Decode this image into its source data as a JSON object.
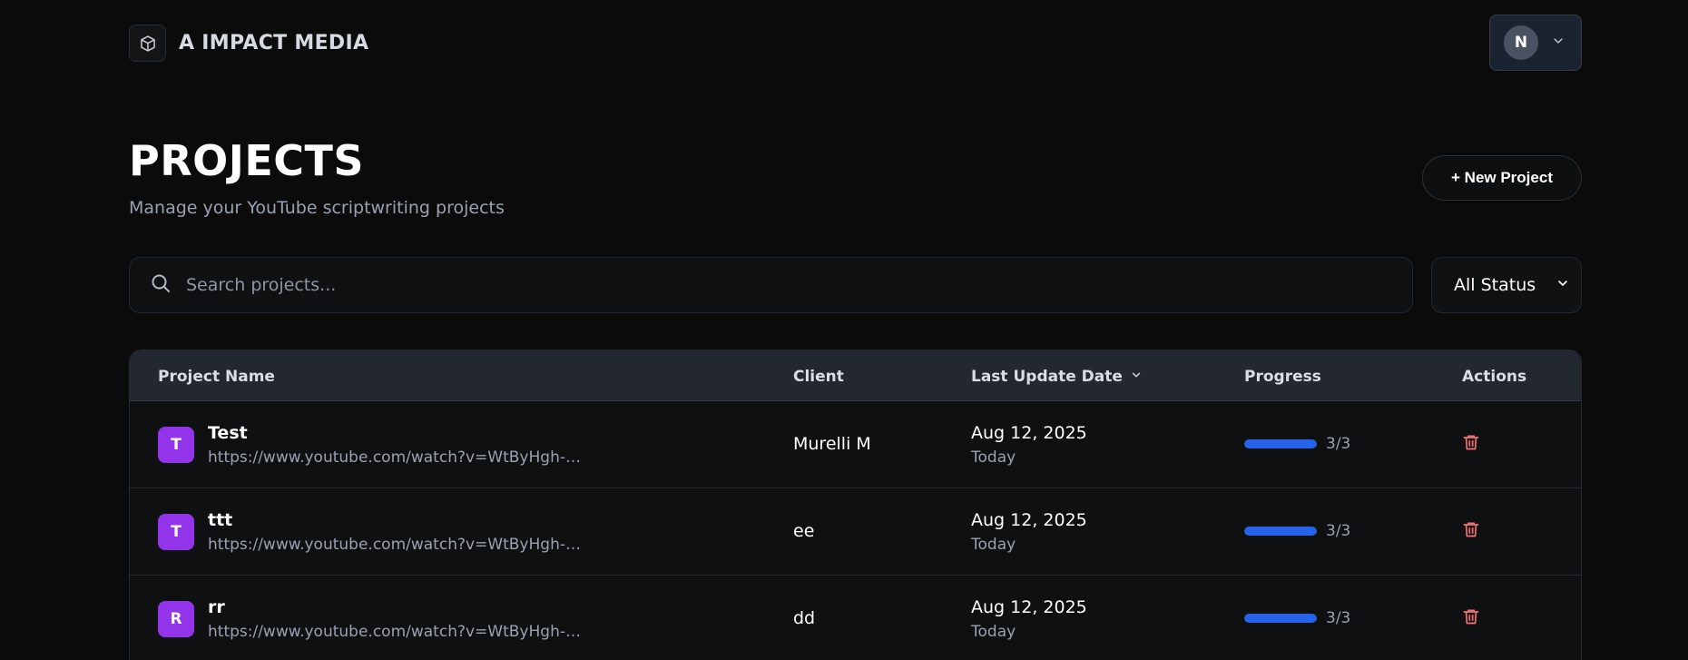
{
  "brand": {
    "name": "A IMPACT MEDIA"
  },
  "user": {
    "initial": "N"
  },
  "header": {
    "title": "PROJECTS",
    "subtitle": "Manage your YouTube scriptwriting projects",
    "new_project_label": "+ New Project"
  },
  "search": {
    "placeholder": "Search projects...",
    "value": ""
  },
  "filter": {
    "selected": "All Status"
  },
  "table": {
    "columns": {
      "name": "Project Name",
      "client": "Client",
      "date": "Last Update Date",
      "progress": "Progress",
      "actions": "Actions"
    },
    "rows": [
      {
        "initial": "T",
        "name": "Test",
        "url": "https://www.youtube.com/watch?v=WtByHgh-75...",
        "client": "Murelli M",
        "date": "Aug 12, 2025",
        "relative": "Today",
        "progress_text": "3/3",
        "progress_fraction": 1.0
      },
      {
        "initial": "T",
        "name": "ttt",
        "url": "https://www.youtube.com/watch?v=WtByHgh-75...",
        "client": "ee",
        "date": "Aug 12, 2025",
        "relative": "Today",
        "progress_text": "3/3",
        "progress_fraction": 1.0
      },
      {
        "initial": "R",
        "name": "rr",
        "url": "https://www.youtube.com/watch?v=WtByHgh-75...",
        "client": "dd",
        "date": "Aug 12, 2025",
        "relative": "Today",
        "progress_text": "3/3",
        "progress_fraction": 1.0
      }
    ]
  },
  "colors": {
    "accent_purple": "#9333ea",
    "progress_blue": "#2563eb",
    "delete_red": "#f87171"
  },
  "icons": {
    "brand": "cube-icon",
    "user_menu": "chevron-down-icon",
    "search": "search-icon",
    "filter": "chevron-down-icon",
    "sort": "chevron-down-icon",
    "delete": "trash-icon"
  }
}
